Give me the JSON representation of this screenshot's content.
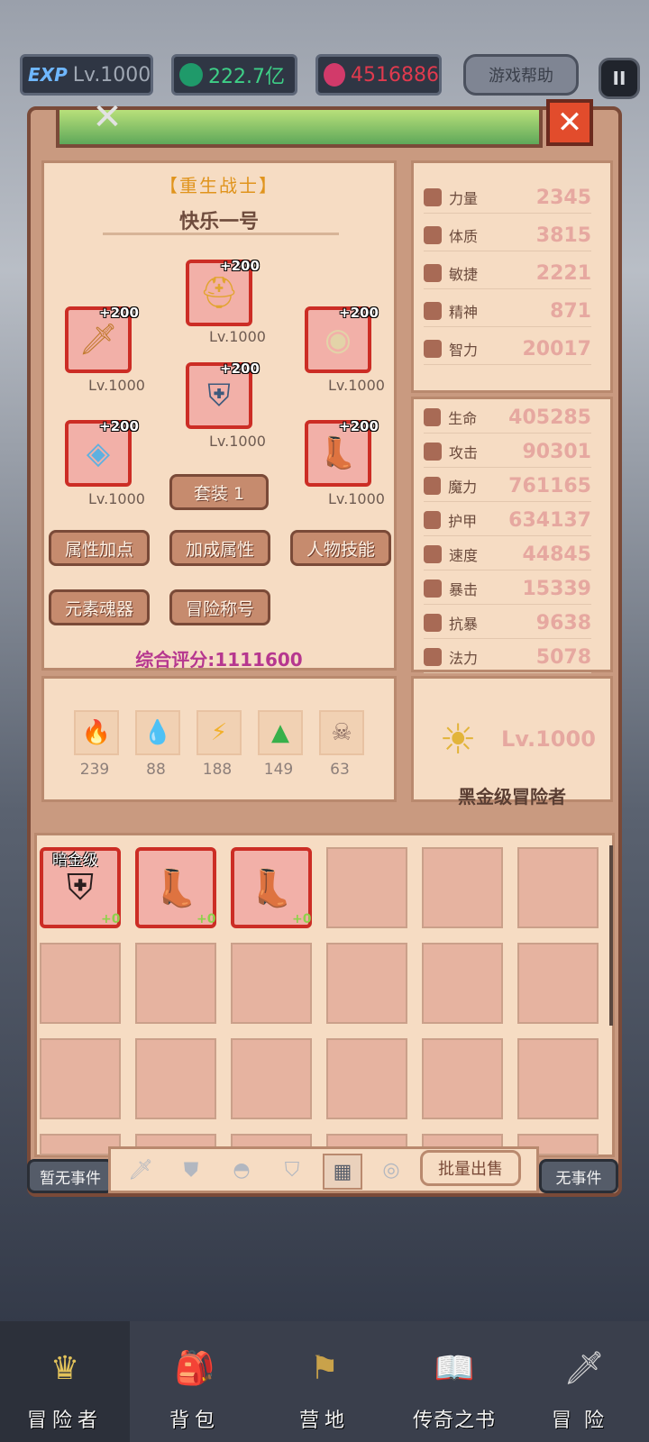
{
  "topbar": {
    "exp_badge": "EXP",
    "level": "Lv.1000",
    "currency_green": "222.7亿",
    "currency_red": "4516886",
    "help_label": "游戏帮助",
    "pause_icon": "pause-icon"
  },
  "character": {
    "class": "【重生战士】",
    "name": "快乐一号",
    "equipment": [
      {
        "slot": "helmet",
        "plus": "+200",
        "level": "Lv.1000",
        "icon": "helmet-icon"
      },
      {
        "slot": "weapon",
        "plus": "+200",
        "level": "Lv.1000",
        "icon": "sword-icon"
      },
      {
        "slot": "shield",
        "plus": "+200",
        "level": "Lv.1000",
        "icon": "shield-icon"
      },
      {
        "slot": "armor",
        "plus": "+200",
        "level": "Lv.1000",
        "icon": "armor-icon"
      },
      {
        "slot": "necklace",
        "plus": "+200",
        "level": "Lv.1000",
        "icon": "necklace-icon"
      },
      {
        "slot": "boots",
        "plus": "+200",
        "level": "Lv.1000",
        "icon": "boots-icon"
      }
    ],
    "set_button": "套装 1",
    "buttons": [
      "属性加点",
      "加成属性",
      "人物技能",
      "元素魂器",
      "冒险称号"
    ],
    "score": "综合评分:1111600"
  },
  "base_stats": [
    {
      "label": "力量",
      "value": "2345"
    },
    {
      "label": "体质",
      "value": "3815"
    },
    {
      "label": "敏捷",
      "value": "2221"
    },
    {
      "label": "精神",
      "value": "871"
    },
    {
      "label": "智力",
      "value": "20017"
    }
  ],
  "combat_stats": [
    {
      "label": "生命",
      "value": "405285"
    },
    {
      "label": "攻击",
      "value": "90301"
    },
    {
      "label": "魔力",
      "value": "761165"
    },
    {
      "label": "护甲",
      "value": "634137"
    },
    {
      "label": "速度",
      "value": "44845"
    },
    {
      "label": "暴击",
      "value": "15339"
    },
    {
      "label": "抗暴",
      "value": "9638"
    },
    {
      "label": "法力",
      "value": "5078"
    }
  ],
  "elements": [
    {
      "icon": "fire-icon",
      "value": "239"
    },
    {
      "icon": "water-icon",
      "value": "88"
    },
    {
      "icon": "lightning-icon",
      "value": "188"
    },
    {
      "icon": "earth-icon",
      "value": "149"
    },
    {
      "icon": "skull-icon",
      "value": "63"
    }
  ],
  "rank": {
    "level": "Lv.1000",
    "title": "黑金级冒险者"
  },
  "inventory": {
    "items": [
      {
        "tag": "暗金级",
        "plus": "+0",
        "icon": "dark-armor-icon"
      },
      {
        "tag": "",
        "plus": "+0",
        "icon": "purple-boots-icon"
      },
      {
        "tag": "",
        "plus": "+0",
        "icon": "black-boots-icon"
      }
    ],
    "sell_label": "批量出售"
  },
  "events": {
    "left": "暂无事件",
    "right": "无事件"
  },
  "nav": [
    "冒险者",
    "背包",
    "营地",
    "传奇之书",
    "冒险"
  ]
}
